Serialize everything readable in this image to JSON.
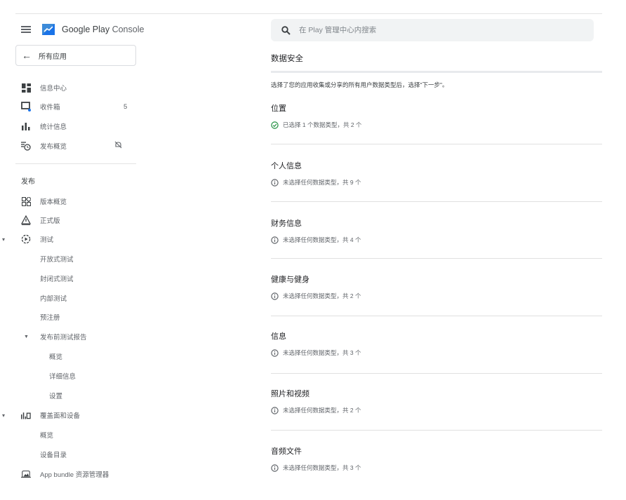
{
  "brand": {
    "name_strong": "Google Play",
    "name_light": " Console"
  },
  "all_apps": {
    "label": "所有应用"
  },
  "nav_top": [
    {
      "label": "信息中心",
      "icon": "dashboard-icon"
    },
    {
      "label": "收件箱",
      "icon": "inbox-icon",
      "count": "5"
    },
    {
      "label": "统计信息",
      "icon": "bar-chart-icon"
    },
    {
      "label": "发布概览",
      "icon": "publishing-overview-icon"
    }
  ],
  "release": {
    "heading": "发布",
    "items": {
      "release_overview": "版本概览",
      "production": "正式版",
      "testing": "测试",
      "open_testing": "开放式测试",
      "closed_testing": "封闭式测试",
      "internal_testing": "内部测试",
      "preregistration": "预注册",
      "prelaunch_report": "发布前测试报告",
      "report_overview": "概览",
      "report_details": "详细信息",
      "report_settings": "设置",
      "reach_devices": "覆盖面和设备",
      "reach_overview": "概览",
      "device_catalog": "设备目录",
      "bundle_explorer": "App bundle 资源管理器"
    }
  },
  "search": {
    "placeholder": "在 Play 管理中心内搜索"
  },
  "page": {
    "title": "数据安全",
    "intro": "选择了您的应用收集或分享的所有用户数据类型后，选择\"下一步\"。"
  },
  "categories": [
    {
      "title": "位置",
      "status": "已选择 1 个数据类型，共 2 个",
      "selected": true
    },
    {
      "title": "个人信息",
      "status": "未选择任何数据类型，共 9 个",
      "selected": false
    },
    {
      "title": "财务信息",
      "status": "未选择任何数据类型，共 4 个",
      "selected": false
    },
    {
      "title": "健康与健身",
      "status": "未选择任何数据类型，共 2 个",
      "selected": false
    },
    {
      "title": "信息",
      "status": "未选择任何数据类型，共 3 个",
      "selected": false
    },
    {
      "title": "照片和视频",
      "status": "未选择任何数据类型，共 2 个",
      "selected": false
    },
    {
      "title": "音频文件",
      "status": "未选择任何数据类型，共 3 个",
      "selected": false
    }
  ],
  "colors": {
    "selected_green": "#1e8e3e",
    "info_gray": "#5f6368"
  }
}
